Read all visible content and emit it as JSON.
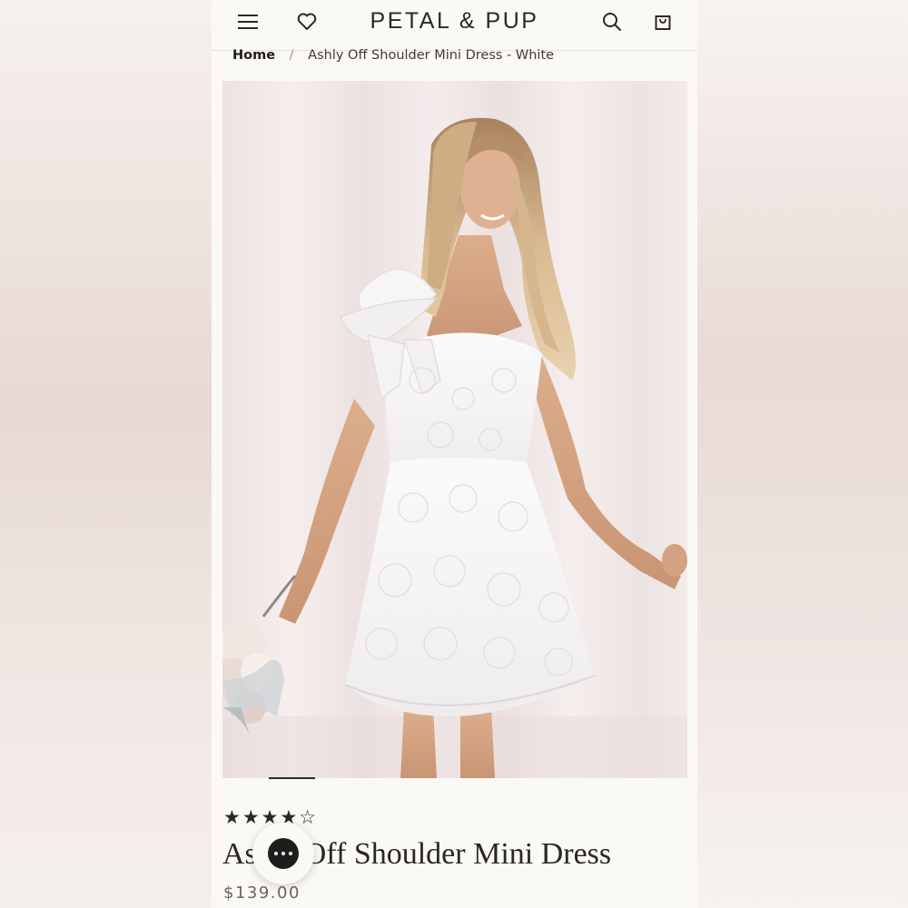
{
  "header": {
    "brand": "PETAL & PUP",
    "icons": [
      "menu-icon",
      "heart-icon",
      "search-icon",
      "shopping-bag-icon"
    ]
  },
  "breadcrumb": {
    "home": "Home",
    "separator": "/",
    "current": "Ashly Off Shoulder Mini Dress - White"
  },
  "product": {
    "rating_stars": "★★★★☆",
    "rating": 4,
    "rating_max": 5,
    "title": "Ashly Off Shoulder Mini Dress",
    "price": "$139.00"
  },
  "chat": {
    "icon": "chat-bubble-icon"
  },
  "colors": {
    "text_primary": "#2a2726",
    "background": "#fbf9f6"
  }
}
